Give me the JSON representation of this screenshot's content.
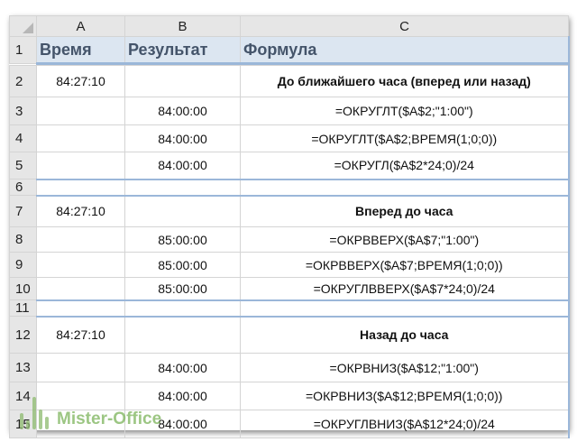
{
  "columns": [
    "A",
    "B",
    "C"
  ],
  "header": {
    "time": "Время",
    "result": "Результат",
    "formula": "Формула"
  },
  "rows": [
    {
      "n": "2",
      "a": "84:27:10",
      "b": "",
      "c": "До ближайшего часа (вперед или назад)"
    },
    {
      "n": "3",
      "a": "",
      "b": "84:00:00",
      "c": "=ОКРУГЛТ($A$2;\"1:00\")"
    },
    {
      "n": "4",
      "a": "",
      "b": "84:00:00",
      "c": "=ОКРУГЛТ($A$2;ВРЕМЯ(1;0;0))"
    },
    {
      "n": "5",
      "a": "",
      "b": "84:00:00",
      "c": "=ОКРУГЛ($A$2*24;0)/24"
    },
    {
      "n": "6",
      "a": "",
      "b": "",
      "c": ""
    },
    {
      "n": "7",
      "a": "84:27:10",
      "b": "",
      "c": "Вперед до часа"
    },
    {
      "n": "8",
      "a": "",
      "b": "85:00:00",
      "c": "=ОКРВВЕРХ($A$7;\"1:00\")"
    },
    {
      "n": "9",
      "a": "",
      "b": "85:00:00",
      "c": "=ОКРВВЕРХ($A$7;ВРЕМЯ(1;0;0))"
    },
    {
      "n": "10",
      "a": "",
      "b": "85:00:00",
      "c": "=ОКРУГЛВВЕРХ($A$7*24;0)/24"
    },
    {
      "n": "11",
      "a": "",
      "b": "",
      "c": ""
    },
    {
      "n": "12",
      "a": "84:27:10",
      "b": "",
      "c": "Назад до часа"
    },
    {
      "n": "13",
      "a": "",
      "b": "84:00:00",
      "c": "=ОКРВНИЗ($A$12;\"1:00\")"
    },
    {
      "n": "14",
      "a": "",
      "b": "84:00:00",
      "c": "=ОКРВНИЗ($A$12;ВРЕМЯ(1;0;0))"
    },
    {
      "n": "15",
      "a": "",
      "b": "84:00:00",
      "c": "=ОКРУГЛВНИЗ($A$12*24;0)/24"
    }
  ],
  "watermark": "Mister-Office"
}
